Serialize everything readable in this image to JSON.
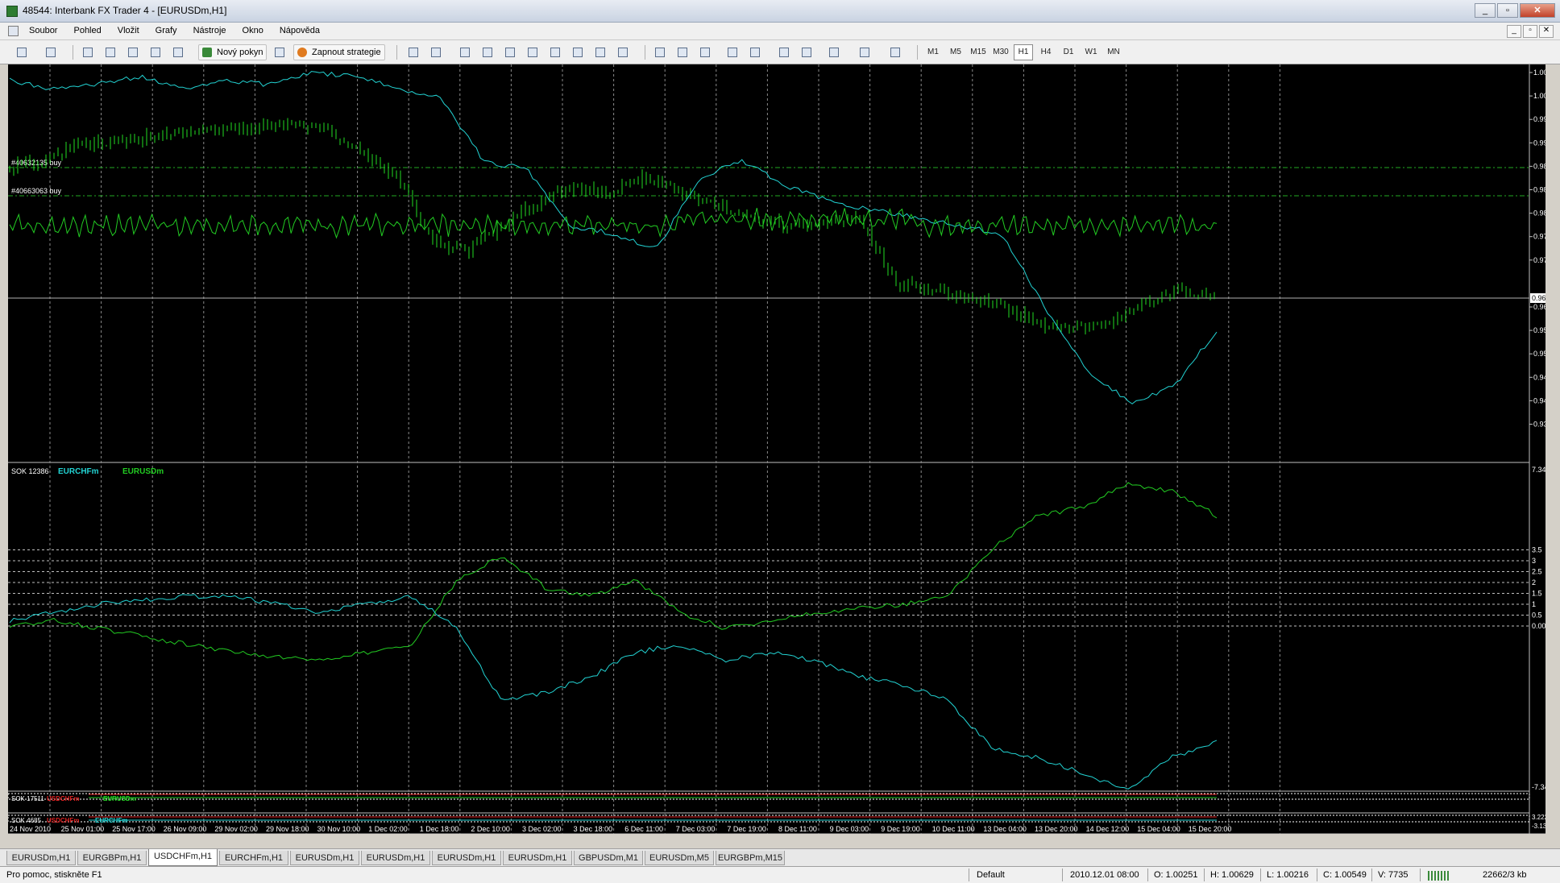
{
  "window": {
    "title": "48544: Interbank FX Trader 4 - [EURUSDm,H1]"
  },
  "menu": [
    "Soubor",
    "Pohled",
    "Vložit",
    "Grafy",
    "Nástroje",
    "Okno",
    "Nápověda"
  ],
  "toolbar": {
    "new_order": "Nový pokyn",
    "strategies": "Zapnout strategie",
    "timeframes": [
      "M1",
      "M5",
      "M15",
      "M30",
      "H1",
      "H4",
      "D1",
      "W1",
      "MN"
    ],
    "active_timeframe": "H1"
  },
  "main_chart": {
    "price_labels": [
      "1.00850",
      "1.00380",
      "0.99910",
      "0.99440",
      "0.98970",
      "0.98500",
      "0.98030",
      "0.97560",
      "0.97090",
      "0.96150",
      "0.95680",
      "0.95210",
      "0.94740",
      "0.94270",
      "0.93800"
    ],
    "current_price": "0.96714",
    "order_labels": [
      "#40632135 buy",
      "#40663063 buy"
    ]
  },
  "indicator1": {
    "name": "SOK 12386",
    "series": [
      {
        "name": "EURCHFm",
        "color": "#22d3d3"
      },
      {
        "name": "EURUSDm",
        "color": "#22cc22"
      }
    ],
    "scale_top": "7.3414",
    "scale_bottom": "-7.3414",
    "levels": [
      "3.5",
      "3",
      "2.5",
      "2",
      "1.5",
      "1",
      "0.5",
      "0.00"
    ]
  },
  "indicator2": {
    "name": "SOK 17511",
    "series": [
      "USDCHFm",
      "EURUSDm"
    ],
    "colors": [
      "#e02020",
      "#22cc22"
    ]
  },
  "indicator3": {
    "name": "SOK 4685",
    "series": [
      "USDCHFm",
      "EURCHFm"
    ],
    "colors": [
      "#e02020",
      "#22d3d3"
    ],
    "scale": [
      "3.222",
      "-3.1322"
    ]
  },
  "time_labels": [
    "24 Nov 2010",
    "25 Nov 01:00",
    "25 Nov 17:00",
    "26 Nov 09:00",
    "29 Nov 02:00",
    "29 Nov 18:00",
    "30 Nov 10:00",
    "1 Dec 02:00",
    "1 Dec 18:00",
    "2 Dec 10:00",
    "3 Dec 02:00",
    "3 Dec 18:00",
    "6 Dec 11:00",
    "7 Dec 03:00",
    "7 Dec 19:00",
    "8 Dec 11:00",
    "9 Dec 03:00",
    "9 Dec 19:00",
    "10 Dec 11:00",
    "13 Dec 04:00",
    "13 Dec 20:00",
    "14 Dec 12:00",
    "15 Dec 04:00",
    "15 Dec 20:00"
  ],
  "tabs": [
    "EURUSDm,H1",
    "EURGBPm,H1",
    "USDCHFm,H1",
    "EURCHFm,H1",
    "EURUSDm,H1",
    "EURUSDm,H1",
    "EURUSDm,H1",
    "EURUSDm,H1",
    "GBPUSDm,M1",
    "EURUSDm,M5",
    "EURGBPm,M15"
  ],
  "active_tab": 2,
  "status": {
    "help": "Pro pomoc, stiskněte F1",
    "profile": "Default",
    "datetime": "2010.12.01 08:00",
    "open": "O: 1.00251",
    "high": "H: 1.00629",
    "low": "L: 1.00216",
    "close": "C: 1.00549",
    "volume": "V: 7735",
    "traffic": "22662/3 kb"
  }
}
